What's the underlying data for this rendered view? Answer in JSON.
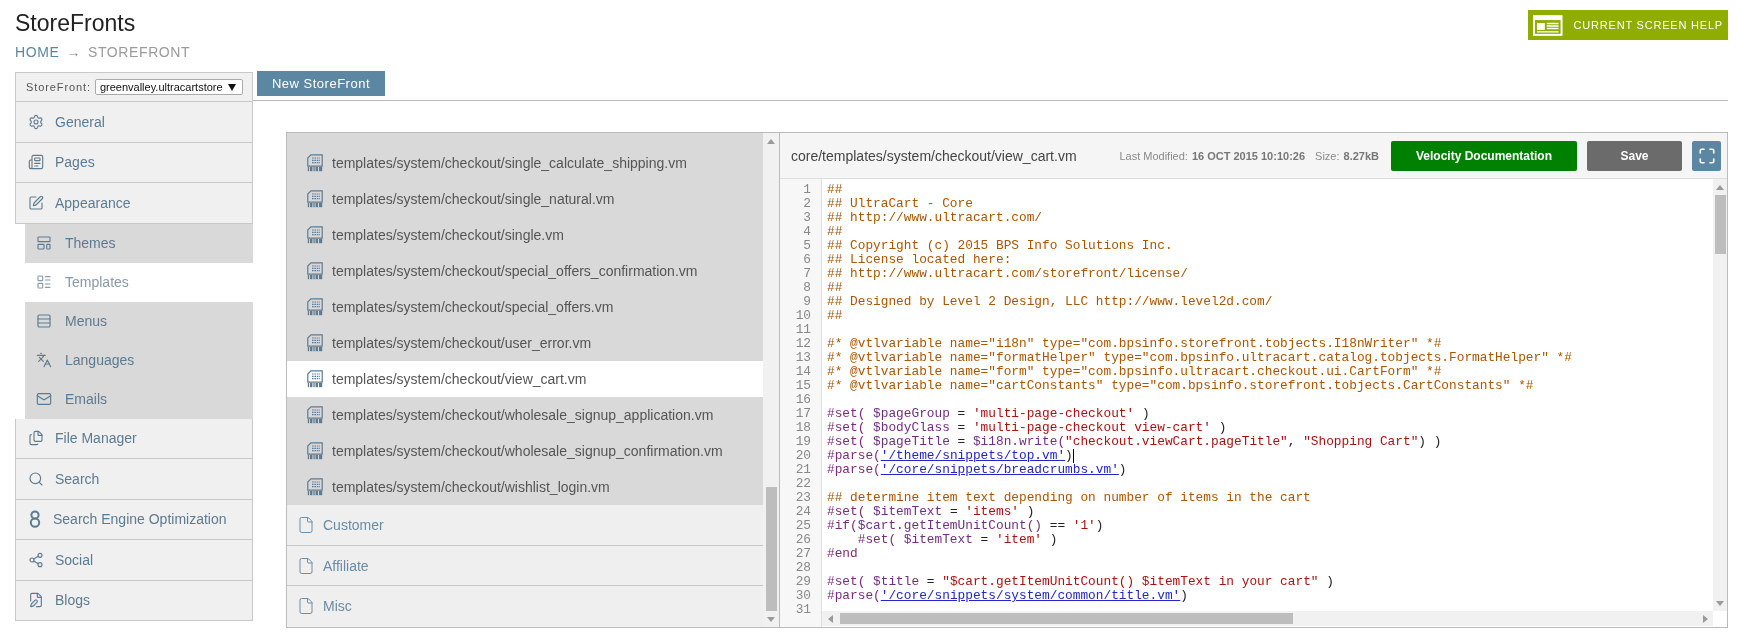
{
  "header": {
    "title": "StoreFronts",
    "breadcrumb": [
      {
        "label": "HOME",
        "current": false
      },
      {
        "label": "STOREFRONT",
        "current": true
      }
    ],
    "separator": "→",
    "help_button": "CURRENT SCREEN HELP"
  },
  "sidebar": {
    "storefront_label": "StoreFront:",
    "storefront_value": "greenvalley.ultracartstore",
    "items": [
      {
        "label": "General",
        "selected": false
      },
      {
        "label": "Pages",
        "selected": false
      },
      {
        "label": "Appearance",
        "selected": false,
        "children": [
          {
            "label": "Themes",
            "selected": false
          },
          {
            "label": "Templates",
            "selected": true
          },
          {
            "label": "Menus",
            "selected": false
          },
          {
            "label": "Languages",
            "selected": false
          },
          {
            "label": "Emails",
            "selected": false
          }
        ]
      },
      {
        "label": "File Manager",
        "selected": false
      },
      {
        "label": "Search",
        "selected": false
      },
      {
        "label": "Search Engine Optimization",
        "selected": false
      },
      {
        "label": "Social",
        "selected": false
      },
      {
        "label": "Blogs",
        "selected": false
      }
    ]
  },
  "toolbar": {
    "new_button": "New StoreFront"
  },
  "file_list": {
    "items": [
      {
        "kind": "file",
        "label": "templates/system/checkout/single_calculate_shipping.vm",
        "selected": false
      },
      {
        "kind": "file",
        "label": "templates/system/checkout/single_natural.vm",
        "selected": false
      },
      {
        "kind": "file",
        "label": "templates/system/checkout/single.vm",
        "selected": false
      },
      {
        "kind": "file",
        "label": "templates/system/checkout/special_offers_confirmation.vm",
        "selected": false
      },
      {
        "kind": "file",
        "label": "templates/system/checkout/special_offers.vm",
        "selected": false
      },
      {
        "kind": "file",
        "label": "templates/system/checkout/user_error.vm",
        "selected": false
      },
      {
        "kind": "file",
        "label": "templates/system/checkout/view_cart.vm",
        "selected": true
      },
      {
        "kind": "file",
        "label": "templates/system/checkout/wholesale_signup_application.vm",
        "selected": false
      },
      {
        "kind": "file",
        "label": "templates/system/checkout/wholesale_signup_confirmation.vm",
        "selected": false
      },
      {
        "kind": "file",
        "label": "templates/system/checkout/wishlist_login.vm",
        "selected": false
      },
      {
        "kind": "folder",
        "label": "Customer",
        "selected": false
      },
      {
        "kind": "folder",
        "label": "Affiliate",
        "selected": false
      },
      {
        "kind": "folder",
        "label": "Misc",
        "selected": false
      }
    ]
  },
  "editor": {
    "file_path": "core/templates/system/checkout/view_cart.vm",
    "last_modified_label": "Last Modified:",
    "last_modified": "16 OCT 2015 10:10:26",
    "size_label": "Size:",
    "size": "8.27kB",
    "buttons": [
      {
        "kind": "primary",
        "label": "Velocity Documentation"
      },
      {
        "kind": "secondary",
        "label": "Save"
      }
    ],
    "lines": [
      {
        "number": "1",
        "tokens": [
          {
            "kind": "comment",
            "text": "##"
          }
        ]
      },
      {
        "number": "2",
        "tokens": [
          {
            "kind": "comment",
            "text": "## UltraCart - Core"
          }
        ]
      },
      {
        "number": "3",
        "tokens": [
          {
            "kind": "comment",
            "text": "## http://www.ultracart.com/"
          }
        ]
      },
      {
        "number": "4",
        "tokens": [
          {
            "kind": "comment",
            "text": "##"
          }
        ]
      },
      {
        "number": "5",
        "tokens": [
          {
            "kind": "comment",
            "text": "## Copyright (c) 2015 BPS Info Solutions Inc."
          }
        ]
      },
      {
        "number": "6",
        "tokens": [
          {
            "kind": "comment",
            "text": "## License located here:"
          }
        ]
      },
      {
        "number": "7",
        "tokens": [
          {
            "kind": "comment",
            "text": "## http://www.ultracart.com/storefront/license/"
          }
        ]
      },
      {
        "number": "8",
        "tokens": [
          {
            "kind": "comment",
            "text": "##"
          }
        ]
      },
      {
        "number": "9",
        "tokens": [
          {
            "kind": "comment",
            "text": "## Designed by Level 2 Design, LLC http://www.level2d.com/"
          }
        ]
      },
      {
        "number": "10",
        "tokens": [
          {
            "kind": "comment",
            "text": "##"
          }
        ]
      },
      {
        "number": "11"
      },
      {
        "number": "12",
        "tokens": [
          {
            "kind": "comment",
            "text": "#* @vtlvariable name=\"i18n\" type=\"com.bpsinfo.storefront.tobjects.I18nWriter\" *#"
          }
        ]
      },
      {
        "number": "13",
        "tokens": [
          {
            "kind": "comment",
            "text": "#* @vtlvariable name=\"formatHelper\" type=\"com.bpsinfo.ultracart.catalog.tobjects.FormatHelper\" *#"
          }
        ]
      },
      {
        "number": "14",
        "tokens": [
          {
            "kind": "comment",
            "text": "#* @vtlvariable name=\"form\" type=\"com.bpsinfo.ultracart.checkout.ui.CartForm\" *#"
          }
        ]
      },
      {
        "number": "15",
        "tokens": [
          {
            "kind": "comment",
            "text": "#* @vtlvariable name=\"cartConstants\" type=\"com.bpsinfo.storefront.tobjects.CartConstants\" *#"
          }
        ]
      },
      {
        "number": "16"
      },
      {
        "number": "17",
        "tokens": [
          {
            "kind": "keyword",
            "text": "#set( "
          },
          {
            "kind": "variable",
            "text": "$pageGroup"
          },
          {
            "kind": "plain",
            "text": " = "
          },
          {
            "kind": "string",
            "text": "'multi-page-checkout'"
          },
          {
            "kind": "plain",
            "text": " )"
          }
        ]
      },
      {
        "number": "18",
        "tokens": [
          {
            "kind": "keyword",
            "text": "#set( "
          },
          {
            "kind": "variable",
            "text": "$bodyClass"
          },
          {
            "kind": "plain",
            "text": " = "
          },
          {
            "kind": "string",
            "text": "'multi-page-checkout view-cart'"
          },
          {
            "kind": "plain",
            "text": " )"
          }
        ]
      },
      {
        "number": "19",
        "tokens": [
          {
            "kind": "keyword",
            "text": "#set( "
          },
          {
            "kind": "variable",
            "text": "$pageTitle"
          },
          {
            "kind": "plain",
            "text": " = "
          },
          {
            "kind": "variable",
            "text": "$i18n.write("
          },
          {
            "kind": "string",
            "text": "\"checkout.viewCart.pageTitle\""
          },
          {
            "kind": "plain",
            "text": ", "
          },
          {
            "kind": "string",
            "text": "\"Shopping Cart\""
          },
          {
            "kind": "plain",
            "text": ") )"
          }
        ]
      },
      {
        "number": "20",
        "tokens": [
          {
            "kind": "keyword",
            "text": "#parse("
          },
          {
            "kind": "link",
            "text": "'/theme/snippets/top.vm'"
          },
          {
            "kind": "plain",
            "text": ")"
          },
          {
            "kind": "cursor"
          }
        ]
      },
      {
        "number": "21",
        "tokens": [
          {
            "kind": "keyword",
            "text": "#parse("
          },
          {
            "kind": "link",
            "text": "'/core/snippets/breadcrumbs.vm'"
          },
          {
            "kind": "plain",
            "text": ")"
          }
        ]
      },
      {
        "number": "22"
      },
      {
        "number": "23",
        "tokens": [
          {
            "kind": "comment",
            "text": "## determine item text depending on number of items in the cart"
          }
        ]
      },
      {
        "number": "24",
        "tokens": [
          {
            "kind": "keyword",
            "text": "#set( "
          },
          {
            "kind": "variable",
            "text": "$itemText"
          },
          {
            "kind": "plain",
            "text": " = "
          },
          {
            "kind": "string",
            "text": "'items'"
          },
          {
            "kind": "plain",
            "text": " )"
          }
        ]
      },
      {
        "number": "25",
        "tokens": [
          {
            "kind": "keyword",
            "text": "#if("
          },
          {
            "kind": "variable",
            "text": "$cart.getItemUnitCount()"
          },
          {
            "kind": "plain",
            "text": " == "
          },
          {
            "kind": "string",
            "text": "'1'"
          },
          {
            "kind": "plain",
            "text": ")"
          }
        ]
      },
      {
        "number": "26",
        "tokens": [
          {
            "kind": "indent"
          },
          {
            "kind": "keyword",
            "text": "#set( "
          },
          {
            "kind": "variable",
            "text": "$itemText"
          },
          {
            "kind": "plain",
            "text": " = "
          },
          {
            "kind": "string",
            "text": "'item'"
          },
          {
            "kind": "plain",
            "text": " )"
          }
        ]
      },
      {
        "number": "27",
        "tokens": [
          {
            "kind": "keyword",
            "text": "#end"
          }
        ]
      },
      {
        "number": "28"
      },
      {
        "number": "29",
        "tokens": [
          {
            "kind": "keyword",
            "text": "#set( "
          },
          {
            "kind": "variable",
            "text": "$title"
          },
          {
            "kind": "plain",
            "text": " = "
          },
          {
            "kind": "string",
            "text": "\"$cart.getItemUnitCount() $itemText in your cart\""
          },
          {
            "kind": "plain",
            "text": " )"
          }
        ]
      },
      {
        "number": "30",
        "tokens": [
          {
            "kind": "keyword",
            "text": "#parse("
          },
          {
            "kind": "link",
            "text": "'/core/snippets/system/common/title.vm'"
          },
          {
            "kind": "plain",
            "text": ")"
          }
        ]
      },
      {
        "number": "31"
      }
    ]
  }
}
